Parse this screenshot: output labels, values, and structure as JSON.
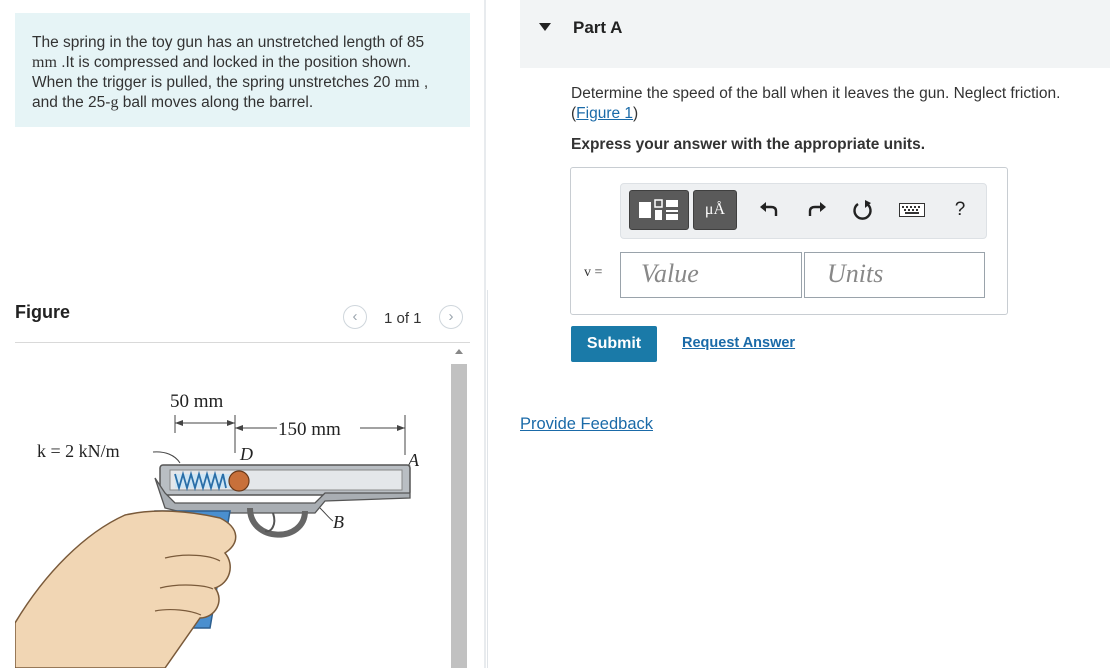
{
  "problem": {
    "line1_a": "The spring in the toy gun has an unstretched length of 85",
    "line2_unit": "mm",
    "line2_rest": " .It is compressed and locked in the position shown.",
    "line3_a": "When the trigger is pulled, the spring unstretches 20 ",
    "line3_unit": "mm",
    "line3_b": " ,",
    "line4_a": "and the 25-",
    "line4_unit": "g",
    "line4_b": " ball moves along the barrel."
  },
  "figure_panel": {
    "heading": "Figure",
    "prev_icon": "‹",
    "next_icon": "›",
    "count": "1 of 1",
    "labels": {
      "dim_50": "50 mm",
      "dim_150": "150 mm",
      "spring_k": "k = 2 kN/m",
      "point_d": "D",
      "point_a": "A",
      "point_b": "B"
    }
  },
  "part": {
    "title": "Part A",
    "question": "Determine the speed of the ball when it leaves the gun. Neglect friction.",
    "figure_link_open": "(",
    "figure_link": "Figure 1",
    "figure_link_close": ")",
    "instruction": "Express your answer with the appropriate units."
  },
  "toolbar": {
    "templates_icon": "templates-icon",
    "units_label": "μÅ",
    "undo_icon": "undo-icon",
    "redo_icon": "redo-icon",
    "reset_icon": "reset-icon",
    "keyboard_icon": "keyboard-icon",
    "help_label": "?"
  },
  "answer": {
    "variable_label": "v =",
    "value_placeholder": "Value",
    "units_placeholder": "Units"
  },
  "actions": {
    "submit": "Submit",
    "request_answer": "Request Answer",
    "provide_feedback": "Provide Feedback"
  },
  "colors": {
    "problem_bg": "#e6f4f6",
    "link": "#1a6aa8",
    "submit_bg": "#1a7aa8"
  }
}
